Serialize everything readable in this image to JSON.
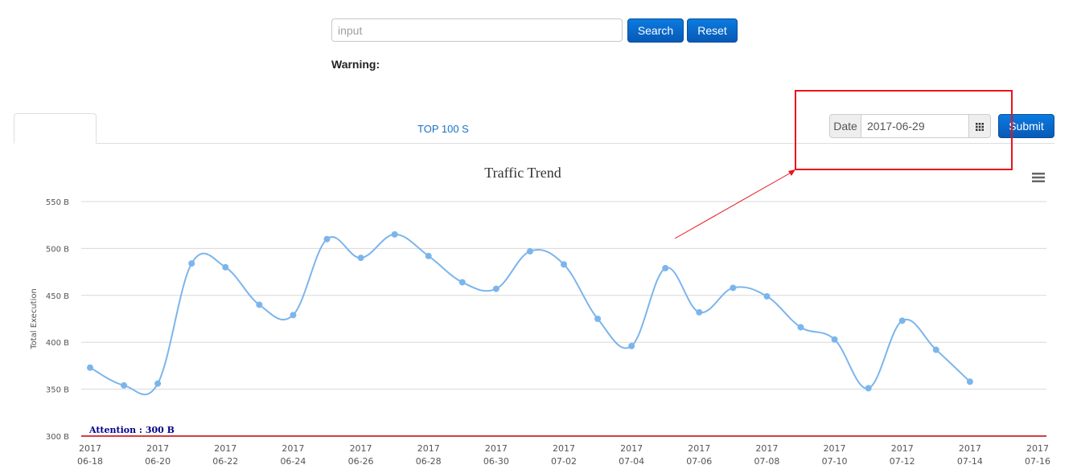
{
  "search": {
    "placeholder": "input",
    "search_label": "Search",
    "reset_label": "Reset",
    "warning_label": "Warning:"
  },
  "tabs": [
    {
      "label": ""
    },
    {
      "label": ""
    },
    {
      "label": ""
    },
    {
      "label": "TOP 100 S"
    },
    {
      "label": ""
    }
  ],
  "date_picker": {
    "label": "Date",
    "value": "2017-06-29",
    "submit_label": "Submit",
    "icon": "calendar-grid-icon"
  },
  "colors": {
    "primary_button": "#0866c6",
    "series": "#7cb5ec",
    "plot_line": "#c00000",
    "plot_line_label": "#00008b",
    "annotation": "#e8141b"
  },
  "chart_data": {
    "type": "line",
    "title": "Traffic Trend",
    "xlabel": "",
    "ylabel": "Total Execution",
    "ylim": [
      300,
      550
    ],
    "yticks": [
      "300 B",
      "350 B",
      "400 B",
      "450 B",
      "500 B",
      "550 B"
    ],
    "ytick_values": [
      300,
      350,
      400,
      450,
      500,
      550
    ],
    "grid": true,
    "smooth": true,
    "x": [
      "2017-06-18",
      "2017-06-19",
      "2017-06-20",
      "2017-06-21",
      "2017-06-22",
      "2017-06-23",
      "2017-06-24",
      "2017-06-25",
      "2017-06-26",
      "2017-06-27",
      "2017-06-28",
      "2017-06-29",
      "2017-06-30",
      "2017-07-01",
      "2017-07-02",
      "2017-07-03",
      "2017-07-04",
      "2017-07-05",
      "2017-07-06",
      "2017-07-07",
      "2017-07-08",
      "2017-07-09",
      "2017-07-10",
      "2017-07-11",
      "2017-07-12",
      "2017-07-13",
      "2017-07-14",
      "2017-07-15",
      "2017-07-16"
    ],
    "xtick_labels": [
      {
        "top": "2017",
        "bottom": "06-18"
      },
      {
        "top": "2017",
        "bottom": "06-20"
      },
      {
        "top": "2017",
        "bottom": "06-22"
      },
      {
        "top": "2017",
        "bottom": "06-24"
      },
      {
        "top": "2017",
        "bottom": "06-26"
      },
      {
        "top": "2017",
        "bottom": "06-28"
      },
      {
        "top": "2017",
        "bottom": "06-30"
      },
      {
        "top": "2017",
        "bottom": "07-02"
      },
      {
        "top": "2017",
        "bottom": "07-04"
      },
      {
        "top": "2017",
        "bottom": "07-06"
      },
      {
        "top": "2017",
        "bottom": "07-08"
      },
      {
        "top": "2017",
        "bottom": "07-10"
      },
      {
        "top": "2017",
        "bottom": "07-12"
      },
      {
        "top": "2017",
        "bottom": "07-14"
      },
      {
        "top": "2017",
        "bottom": "07-16"
      }
    ],
    "series": [
      {
        "values": [
          373,
          354,
          356,
          484,
          480,
          440,
          429,
          510,
          490,
          515,
          492,
          464,
          457,
          497,
          483,
          425,
          396,
          479,
          432,
          458,
          449,
          416,
          403,
          351,
          423,
          392,
          358
        ]
      }
    ],
    "plot_line": {
      "value": 300,
      "label": "Attention : 300 B"
    }
  }
}
